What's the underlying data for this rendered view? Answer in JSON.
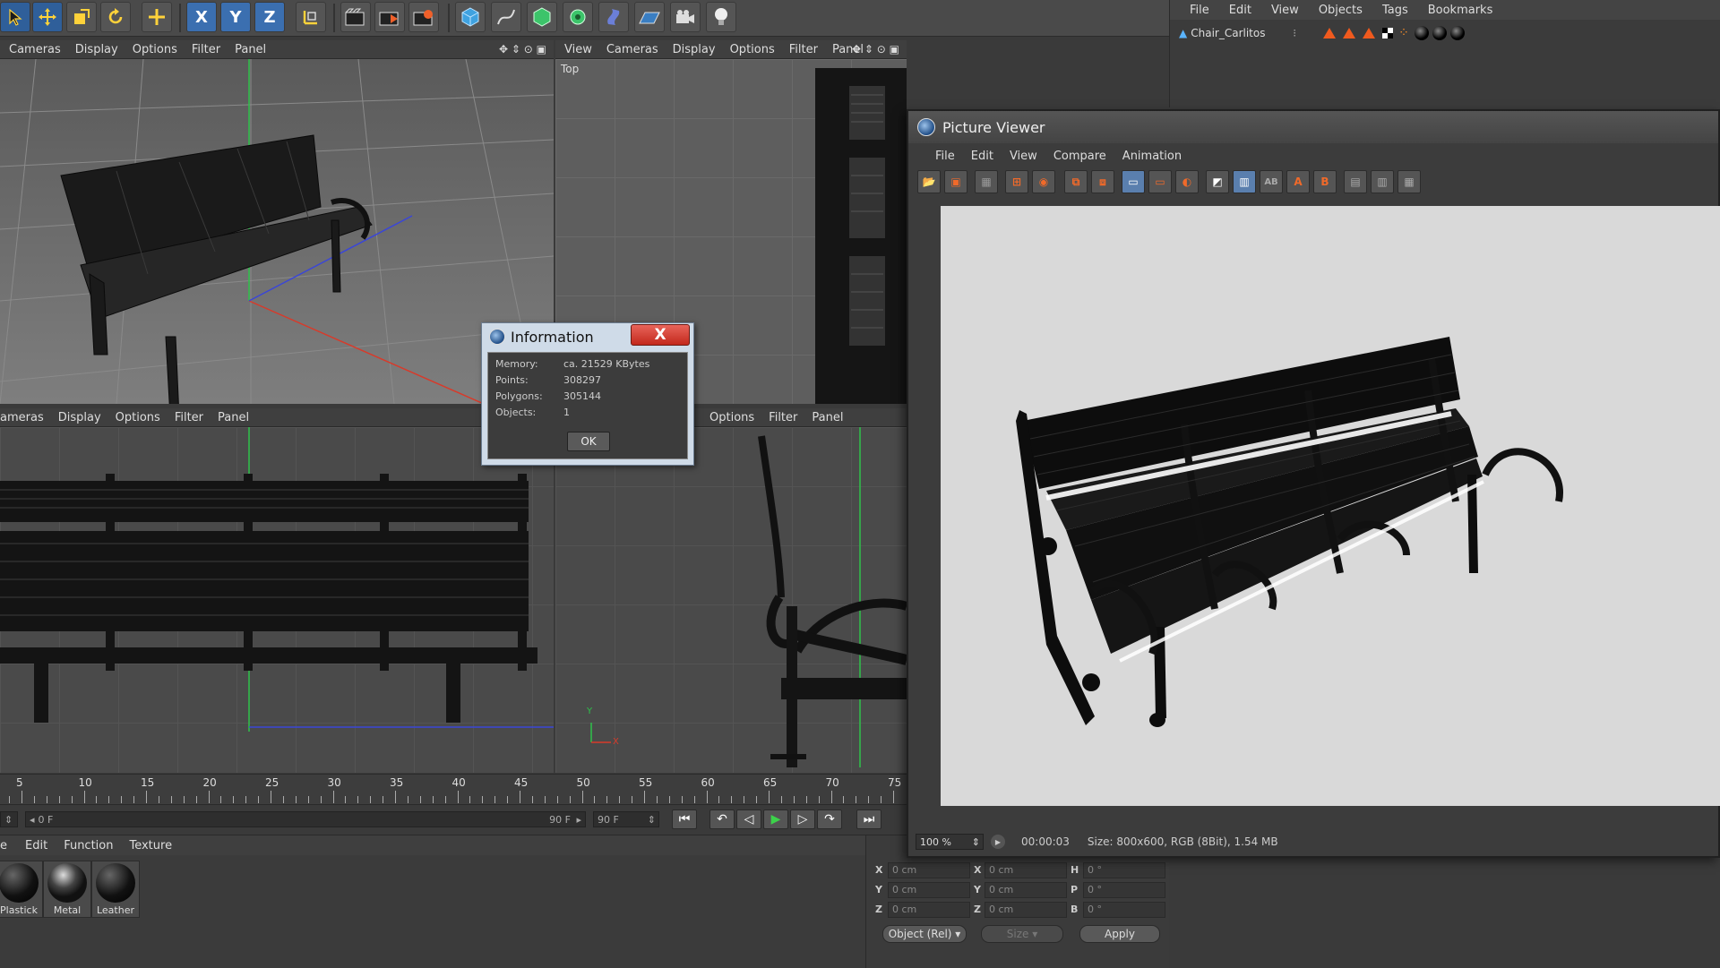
{
  "toolbar": {
    "axis_x": "X",
    "axis_y": "Y",
    "axis_z": "Z"
  },
  "object_manager": {
    "menu": [
      "File",
      "Edit",
      "View",
      "Objects",
      "Tags",
      "Bookmarks"
    ],
    "object_name": "Chair_Carlitos"
  },
  "viewports": {
    "perspective_menu": [
      "Cameras",
      "Display",
      "Options",
      "Filter",
      "Panel"
    ],
    "top_menu": [
      "View",
      "Cameras",
      "Display",
      "Options",
      "Filter",
      "Panel"
    ],
    "top_label": "Top",
    "front_menu": [
      "ameras",
      "Display",
      "Options",
      "Filter",
      "Panel"
    ],
    "right_menu": [
      "Options",
      "Filter",
      "Panel"
    ],
    "axis_y_label": "Y",
    "axis_x_label": "X"
  },
  "timeline": {
    "ticks": [
      "5",
      "10",
      "15",
      "20",
      "25",
      "30",
      "35",
      "40",
      "45",
      "50",
      "55",
      "60",
      "65",
      "70",
      "75"
    ],
    "current_frame": "0 F",
    "slider_end": "90 F",
    "end_frame": "90 F"
  },
  "material_manager": {
    "menu": [
      "e",
      "Edit",
      "Function",
      "Texture"
    ],
    "materials": [
      "Plastick",
      "Metal",
      "Leather"
    ]
  },
  "coordinates": {
    "rows": [
      {
        "pos_label": "X",
        "pos": "0 cm",
        "size_label": "X",
        "size": "0 cm",
        "rot_label": "H",
        "rot": "0 °"
      },
      {
        "pos_label": "Y",
        "pos": "0 cm",
        "size_label": "Y",
        "size": "0 cm",
        "rot_label": "P",
        "rot": "0 °"
      },
      {
        "pos_label": "Z",
        "pos": "0 cm",
        "size_label": "Z",
        "size": "0 cm",
        "rot_label": "B",
        "rot": "0 °"
      }
    ],
    "mode_select": "Object (Rel)",
    "size_select": "Size",
    "apply_label": "Apply"
  },
  "picture_viewer": {
    "title": "Picture Viewer",
    "menu": [
      "File",
      "Edit",
      "View",
      "Compare",
      "Animation"
    ],
    "tool_ab_a": "A",
    "tool_ab_b": "B",
    "tool_ab_text": "AB",
    "zoom": "100 %",
    "time": "00:00:03",
    "size_info": "Size: 800x600, RGB (8Bit), 1.54 MB"
  },
  "info_dialog": {
    "title": "Information",
    "close": "X",
    "memory_label": "Memory:",
    "memory_value": "ca. 21529 KBytes",
    "points_label": "Points:",
    "points_value": "308297",
    "polygons_label": "Polygons:",
    "polygons_value": "305144",
    "objects_label": "Objects:",
    "objects_value": "1",
    "ok_label": "OK"
  },
  "colors": {
    "accent_blue": "#2f5f9a",
    "tag_orange": "#f05a1e",
    "dialog_close_red": "#c3281c"
  }
}
